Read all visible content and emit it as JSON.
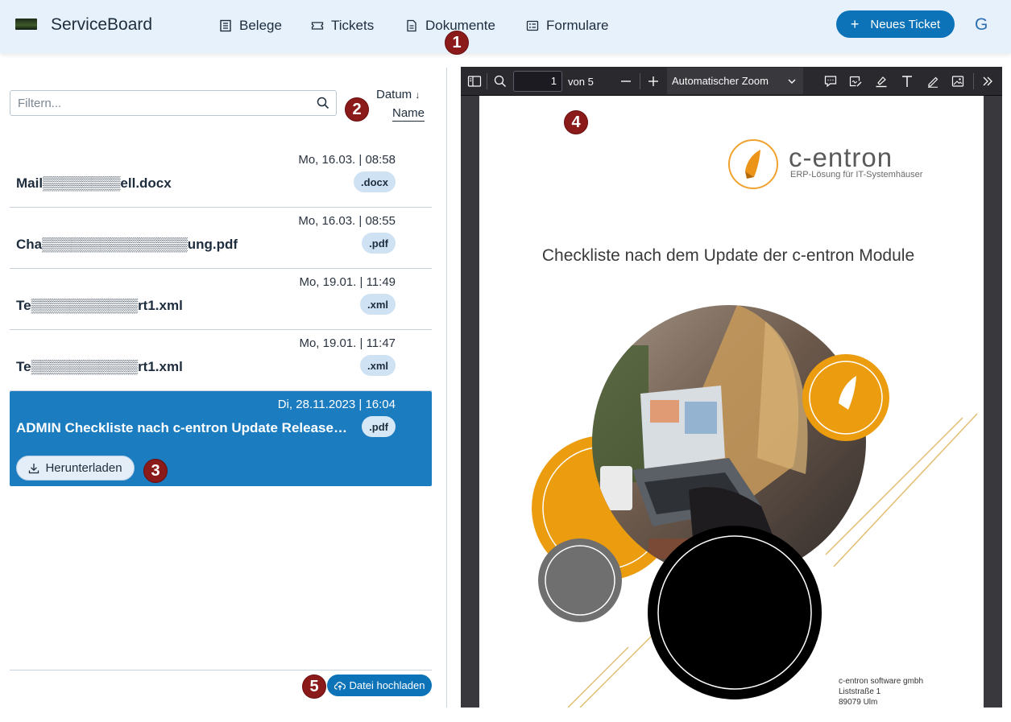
{
  "app": {
    "title": "ServiceBoard",
    "user_initial": "G",
    "nav": [
      {
        "label": "Belege",
        "icon": "receipt-icon"
      },
      {
        "label": "Tickets",
        "icon": "ticket-icon"
      },
      {
        "label": "Dokumente",
        "icon": "document-icon"
      },
      {
        "label": "Formulare",
        "icon": "form-icon"
      }
    ],
    "new_ticket_label": "Neues Ticket",
    "accent_color": "#0c73b8"
  },
  "annotations": [
    "1",
    "2",
    "3",
    "4",
    "5"
  ],
  "documents": {
    "filter_placeholder": "Filtern...",
    "sort": {
      "date_label": "Datum",
      "name_label": "Name",
      "date_arrow": "↓"
    },
    "items": [
      {
        "date": "Mo, 16.03. | 08:58",
        "name": "Mail▒▒▒▒▒▒▒▒ell.docx",
        "ext": ".docx",
        "selected": false
      },
      {
        "date": "Mo, 16.03. | 08:55",
        "name": "Cha▒▒▒▒▒▒▒▒▒▒▒▒▒▒▒ung.pdf",
        "ext": ".pdf",
        "selected": false
      },
      {
        "date": "Mo, 19.01. | 11:49",
        "name": "Te▒▒▒▒▒▒▒▒▒▒▒rt1.xml",
        "ext": ".xml",
        "selected": false
      },
      {
        "date": "Mo, 19.01. | 11:47",
        "name": "Te▒▒▒▒▒▒▒▒▒▒▒rt1.xml",
        "ext": ".xml",
        "selected": false
      },
      {
        "date": "Di, 28.11.2023 | 16:04",
        "name": "ADMIN Checkliste nach c-entron Update Release…",
        "ext": ".pdf",
        "selected": true
      }
    ],
    "download_label": "Herunterladen",
    "upload_label": "Datei hochladen"
  },
  "viewer": {
    "page_number": "1",
    "of_pages": "von 5",
    "zoom": "Automatischer Zoom",
    "pdf": {
      "brand": "c-entron",
      "subtitle": "ERP-Lösung für IT-Systemhäuser",
      "title": "Checkliste nach dem Update der c-entron Module",
      "footer": [
        "c-entron software gmbh",
        "Liststraße 1",
        "89079 Ulm"
      ]
    }
  }
}
